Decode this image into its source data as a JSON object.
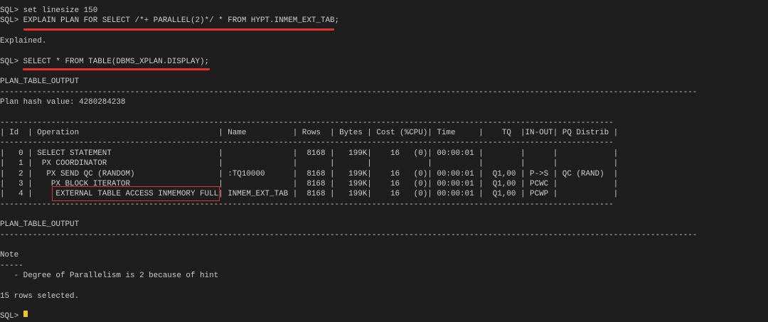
{
  "terminal": {
    "lines": [
      "SQL> set linesize 150",
      "SQL> EXPLAIN PLAN FOR SELECT /*+ PARALLEL(2)*/ * FROM HYPT.INMEM_EXT_TAB;",
      "",
      "Explained.",
      "",
      "SQL> SELECT * FROM TABLE(DBMS_XPLAN.DISPLAY);",
      "",
      "PLAN_TABLE_OUTPUT",
      "------------------------------------------------------------------------------------------------------------------------------------------------------",
      "Plan hash value: 4280284238",
      "",
      "------------------------------------------------------------------------------------------------------------------------------------",
      "| Id  | Operation                              | Name          | Rows  | Bytes | Cost (%CPU)| Time     |    TQ  |IN-OUT| PQ Distrib |",
      "------------------------------------------------------------------------------------------------------------------------------------",
      "|   0 | SELECT STATEMENT                       |               |  8168 |   199K|    16   (0)| 00:00:01 |        |      |            |",
      "|   1 |  PX COORDINATOR                        |               |       |       |            |          |        |      |            |",
      "|   2 |   PX SEND QC (RANDOM)                  | :TQ10000      |  8168 |   199K|    16   (0)| 00:00:01 |  Q1,00 | P->S | QC (RAND)  |",
      "|   3 |    PX BLOCK ITERATOR                   |               |  8168 |   199K|    16   (0)| 00:00:01 |  Q1,00 | PCWC |            |",
      "|   4 |     EXTERNAL TABLE ACCESS INMEMORY FULL| INMEM_EXT_TAB |  8168 |   199K|    16   (0)| 00:00:01 |  Q1,00 | PCWP |            |",
      "------------------------------------------------------------------------------------------------------------------------------------",
      "",
      "PLAN_TABLE_OUTPUT",
      "------------------------------------------------------------------------------------------------------------------------------------------------------",
      "",
      "Note",
      "-----",
      "   - Degree of Parallelism is 2 because of hint",
      "",
      "15 rows selected.",
      "",
      "SQL> "
    ],
    "annotation_color": "#e5342c",
    "cursor_color": "#f5c518"
  }
}
